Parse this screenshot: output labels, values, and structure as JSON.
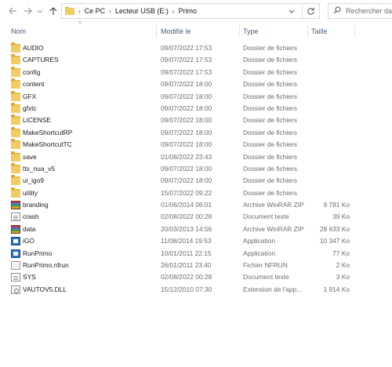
{
  "address": {
    "crumbs": [
      "Ce PC",
      "Lecteur USB (E:)",
      "Primo"
    ]
  },
  "search": {
    "placeholder": "Rechercher dans : Primo"
  },
  "columns": {
    "name": "Nom",
    "date": "Modifié le",
    "type": "Type",
    "size": "Taille"
  },
  "files": [
    {
      "name": "AUDIO",
      "date": "09/07/2022 17:53",
      "type": "Dossier de fichiers",
      "size": "",
      "icon": "folder-icon"
    },
    {
      "name": "CAPTURES",
      "date": "09/07/2022 17:53",
      "type": "Dossier de fichiers",
      "size": "",
      "icon": "folder-icon"
    },
    {
      "name": "config",
      "date": "09/07/2022 17:53",
      "type": "Dossier de fichiers",
      "size": "",
      "icon": "folder-icon"
    },
    {
      "name": "content",
      "date": "09/07/2022 18:00",
      "type": "Dossier de fichiers",
      "size": "",
      "icon": "folder-icon"
    },
    {
      "name": "GFX",
      "date": "09/07/2022 18:00",
      "type": "Dossier de fichiers",
      "size": "",
      "icon": "folder-icon"
    },
    {
      "name": "gfxtc",
      "date": "09/07/2022 18:00",
      "type": "Dossier de fichiers",
      "size": "",
      "icon": "folder-icon"
    },
    {
      "name": "LICENSE",
      "date": "09/07/2022 18:00",
      "type": "Dossier de fichiers",
      "size": "",
      "icon": "folder-icon"
    },
    {
      "name": "MakeShortcutRP",
      "date": "09/07/2022 18:00",
      "type": "Dossier de fichiers",
      "size": "",
      "icon": "folder-icon"
    },
    {
      "name": "MakeShortcutTC",
      "date": "09/07/2022 18:00",
      "type": "Dossier de fichiers",
      "size": "",
      "icon": "folder-icon"
    },
    {
      "name": "save",
      "date": "01/08/2022 23:43",
      "type": "Dossier de fichiers",
      "size": "",
      "icon": "folder-icon"
    },
    {
      "name": "tts_nua_v5",
      "date": "09/07/2022 18:00",
      "type": "Dossier de fichiers",
      "size": "",
      "icon": "folder-icon"
    },
    {
      "name": "ui_igo9",
      "date": "09/07/2022 18:00",
      "type": "Dossier de fichiers",
      "size": "",
      "icon": "folder-icon"
    },
    {
      "name": "utility",
      "date": "15/07/2022 09:22",
      "type": "Dossier de fichiers",
      "size": "",
      "icon": "folder-icon"
    },
    {
      "name": "branding",
      "date": "01/06/2014 06:01",
      "type": "Archive WinRAR ZIP",
      "size": "9 781 Ko",
      "icon": "winrar-icon"
    },
    {
      "name": "crash",
      "date": "02/08/2022 00:28",
      "type": "Document texte",
      "size": "39 Ko",
      "icon": "text-file-icon"
    },
    {
      "name": "data",
      "date": "20/03/2013 14:56",
      "type": "Archive WinRAR ZIP",
      "size": "28 633 Ko",
      "icon": "winrar-icon"
    },
    {
      "name": "iGO",
      "date": "11/08/2014 19:53",
      "type": "Application",
      "size": "10 347 Ko",
      "icon": "application-icon"
    },
    {
      "name": "RunPrimo",
      "date": "10/01/2011 22:15",
      "type": "Application",
      "size": "77 Ko",
      "icon": "application-icon"
    },
    {
      "name": "RunPrimo.nfrun",
      "date": "26/01/2011 23:40",
      "type": "Fichier NFRUN",
      "size": "2 Ko",
      "icon": "blank-file-icon"
    },
    {
      "name": "SYS",
      "date": "02/08/2022 00:28",
      "type": "Document texte",
      "size": "3 Ko",
      "icon": "text-file-icon"
    },
    {
      "name": "VAUTOV5.DLL",
      "date": "15/12/2010 07:30",
      "type": "Extension de l'app...",
      "size": "1 914 Ko",
      "icon": "dll-file-icon"
    }
  ]
}
